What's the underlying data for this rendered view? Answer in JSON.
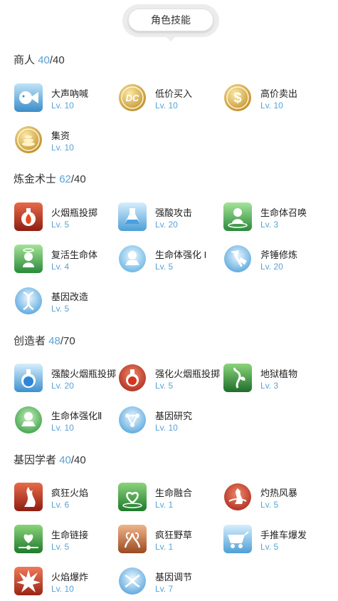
{
  "header": {
    "title": "角色技能"
  },
  "sections": [
    {
      "name": "商人",
      "current": "40",
      "max": "/40",
      "skills": [
        {
          "name": "大声吶喊",
          "level": "Lv. 10",
          "icon": "shout-icon"
        },
        {
          "name": "低价买入",
          "level": "Lv. 10",
          "icon": "dc-coin-icon"
        },
        {
          "name": "高价卖出",
          "level": "Lv. 10",
          "icon": "dollar-coin-icon"
        },
        {
          "name": "集资",
          "level": "Lv. 10",
          "icon": "fundraise-coin-icon"
        }
      ]
    },
    {
      "name": "炼金术士",
      "current": "62",
      "max": "/40",
      "skills": [
        {
          "name": "火烟瓶投掷",
          "level": "Lv. 5",
          "icon": "fire-flask-icon"
        },
        {
          "name": "强酸攻击",
          "level": "Lv. 20",
          "icon": "acid-flask-icon"
        },
        {
          "name": "生命体召唤",
          "level": "Lv. 3",
          "icon": "summon-homunculus-icon"
        },
        {
          "name": "复活生命体",
          "level": "Lv. 4",
          "icon": "resurrect-homunculus-icon"
        },
        {
          "name": "生命体强化 I",
          "level": "Lv. 5",
          "icon": "homunculus-mastery-icon"
        },
        {
          "name": "斧锤修炼",
          "level": "Lv. 20",
          "icon": "axe-hammer-icon"
        },
        {
          "name": "基因改造",
          "level": "Lv. 5",
          "icon": "dna-icon"
        }
      ]
    },
    {
      "name": "创造者",
      "current": "48",
      "max": "/70",
      "skills": [
        {
          "name": "强酸火烟瓶投掷",
          "level": "Lv. 20",
          "icon": "acid-demonstration-icon"
        },
        {
          "name": "强化火烟瓶投掷",
          "level": "Lv. 5",
          "icon": "enhanced-fire-flask-icon"
        },
        {
          "name": "地狱植物",
          "level": "Lv. 3",
          "icon": "hell-plant-icon"
        },
        {
          "name": "生命体强化Ⅱ",
          "level": "Lv. 10",
          "icon": "homunculus-mastery-2-icon"
        },
        {
          "name": "基因研究",
          "level": "Lv. 10",
          "icon": "gene-research-icon"
        }
      ]
    },
    {
      "name": "基因学者",
      "current": "40",
      "max": "/40",
      "skills": [
        {
          "name": "疯狂火焰",
          "level": "Lv. 6",
          "icon": "crazy-flame-icon"
        },
        {
          "name": "生命融合",
          "level": "Lv. 1",
          "icon": "life-fusion-icon"
        },
        {
          "name": "灼热风暴",
          "level": "Lv. 5",
          "icon": "scorching-storm-icon"
        },
        {
          "name": "生命链接",
          "level": "Lv. 5",
          "icon": "life-link-icon"
        },
        {
          "name": "疯狂野草",
          "level": "Lv. 1",
          "icon": "crazy-weed-icon"
        },
        {
          "name": "手推车爆发",
          "level": "Lv. 5",
          "icon": "cart-boost-icon"
        },
        {
          "name": "火焰爆炸",
          "level": "Lv. 10",
          "icon": "flame-explosion-icon"
        },
        {
          "name": "基因调节",
          "level": "Lv. 7",
          "icon": "gene-adjust-icon"
        }
      ]
    }
  ],
  "colors": {
    "accent": "#5aa2d6",
    "gold": "#d6aa3c",
    "fire": "#c9341e",
    "green": "#3eaa4a",
    "blue": "#54a6dc"
  }
}
